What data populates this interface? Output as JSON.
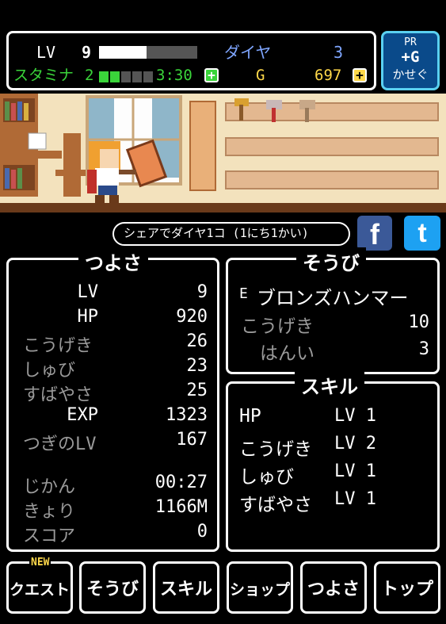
{
  "status": {
    "lv_label": "LV",
    "lv_value": "9",
    "dia_label": "ダイヤ",
    "dia_value": "3",
    "stamina_label": "スタミナ",
    "stamina_value": "2",
    "stamina_timer": "3:30",
    "stamina_filled": 2,
    "stamina_total": 5,
    "gold_label": "G",
    "gold_value": "697",
    "exp_progress": 0.48
  },
  "pr_button": {
    "line1": "PR",
    "line2": "+G",
    "line3": "かせぐ"
  },
  "share": {
    "text": "シェアでダイヤ1コ (1にち1かい)",
    "facebook": "f",
    "twitter": "t"
  },
  "strength": {
    "title": "つよさ",
    "rows": [
      {
        "label": "LV",
        "value": "9"
      },
      {
        "label": "HP",
        "value": "920"
      },
      {
        "label": "こうげき",
        "value": "26"
      },
      {
        "label": "しゅび",
        "value": "23"
      },
      {
        "label": "すばやさ",
        "value": "25"
      },
      {
        "label": "EXP",
        "value": "1323"
      },
      {
        "label": "つぎのLV",
        "value": "167"
      }
    ],
    "rows2": [
      {
        "label": "じかん",
        "value": "00:27"
      },
      {
        "label": "きょり",
        "value": "1166M"
      },
      {
        "label": "スコア",
        "value": "0"
      }
    ]
  },
  "equip": {
    "title": "そうび",
    "item_prefix": "E",
    "item_name": "ブロンズハンマー",
    "attack_label": "こうげき",
    "attack_value": "10",
    "range_label": "はんい",
    "range_value": "3"
  },
  "skill": {
    "title": "スキル",
    "rows": [
      {
        "name": "HP",
        "level": "LV 1"
      },
      {
        "name": "こうげき",
        "level": "LV 2"
      },
      {
        "name": "しゅび",
        "level": "LV 1"
      },
      {
        "name": "すばやさ",
        "level": "LV 1"
      }
    ]
  },
  "nav": {
    "new_badge": "NEW",
    "items": [
      "クエスト",
      "そうび",
      "スキル",
      "ショップ",
      "つよさ",
      "トップ"
    ]
  },
  "colors": {
    "green": "#3ad43a",
    "yellow": "#ffd84a",
    "facebook": "#3b5998",
    "twitter": "#1da1f2"
  }
}
